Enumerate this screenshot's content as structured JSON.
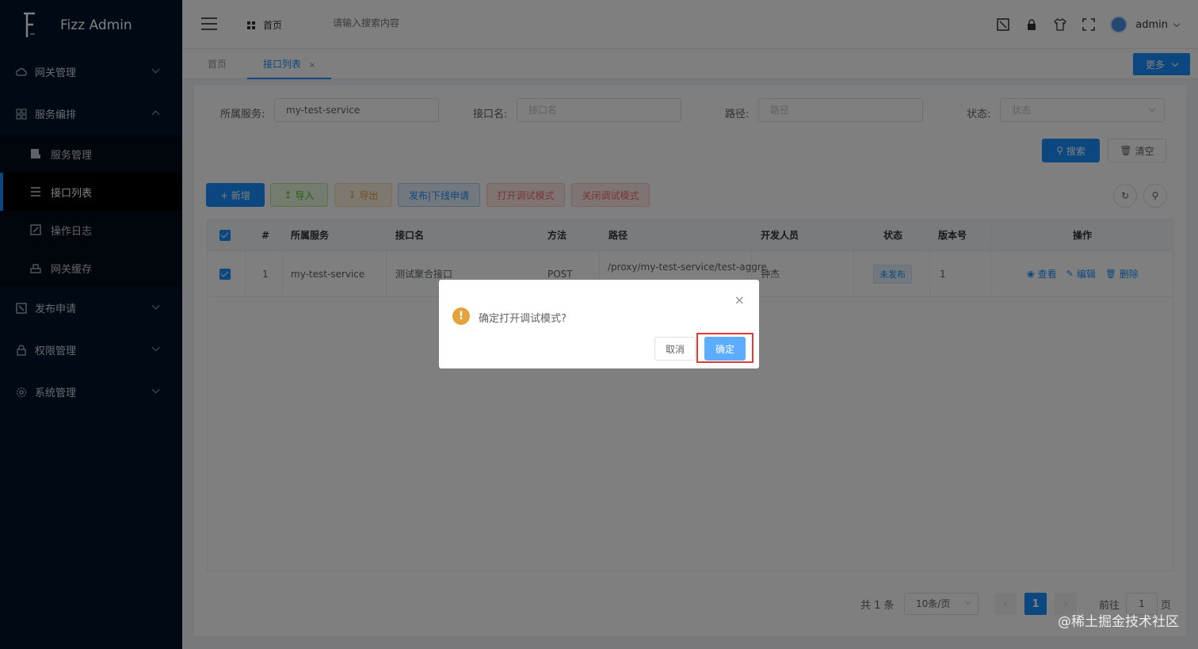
{
  "app": {
    "title": "Fizz Admin"
  },
  "sidebar": {
    "items": [
      {
        "label": "网关管理",
        "icon": "cloud-icon"
      },
      {
        "label": "服务编排",
        "icon": "grid-icon",
        "expanded": true,
        "children": [
          {
            "label": "服务管理",
            "icon": "server-icon"
          },
          {
            "label": "接口列表",
            "icon": "list-icon",
            "active": true
          },
          {
            "label": "操作日志",
            "icon": "log-icon"
          },
          {
            "label": "网关缓存",
            "icon": "cache-icon"
          }
        ]
      },
      {
        "label": "发布申请",
        "icon": "publish-icon"
      },
      {
        "label": "权限管理",
        "icon": "lock-icon"
      },
      {
        "label": "系统管理",
        "icon": "gear-icon"
      }
    ]
  },
  "header": {
    "home": "首页",
    "search_placeholder": "请输入搜索内容",
    "user": "admin"
  },
  "tabs": {
    "home": "首页",
    "active": "接口列表",
    "close": "×",
    "more": "更多"
  },
  "filters": {
    "service_label": "所属服务:",
    "service_value": "my-test-service",
    "api_label": "接口名:",
    "api_placeholder": "接口名",
    "path_label": "路径:",
    "path_placeholder": "路径",
    "status_label": "状态:",
    "status_placeholder": "状态",
    "search_btn": "搜索",
    "clear_btn": "清空"
  },
  "toolbar": {
    "add": "+ 新增",
    "import": "导入",
    "export": "导出",
    "publish": "发布|下线申请",
    "open_debug": "打开调试模式",
    "close_debug": "关闭调试模式"
  },
  "table": {
    "headers": [
      "#",
      "所属服务",
      "接口名",
      "方法",
      "路径",
      "开发人员",
      "状态",
      "版本号",
      "操作"
    ],
    "rows": [
      {
        "index": "1",
        "service": "my-test-service",
        "name": "测试聚合接口",
        "method": "POST",
        "path": "/proxy/my-test-service/test-aggre",
        "developer": "钟杰",
        "status": "未发布",
        "version": "1",
        "ops": [
          "查看",
          "编辑",
          "删除"
        ]
      }
    ]
  },
  "pagination": {
    "total": "共 1 条",
    "page_size": "10条/页",
    "current": "1",
    "goto_label": "前往",
    "goto_value": "1",
    "page_unit": "页"
  },
  "dialog": {
    "message": "确定打开调试模式?",
    "cancel": "取消",
    "confirm": "确定",
    "close": "×"
  },
  "watermark": "@稀土掘金技术社区",
  "colors": {
    "primary": "#1890ff",
    "sidebar": "#001529",
    "warning": "#e6a23c",
    "highlight": "#e53935"
  }
}
